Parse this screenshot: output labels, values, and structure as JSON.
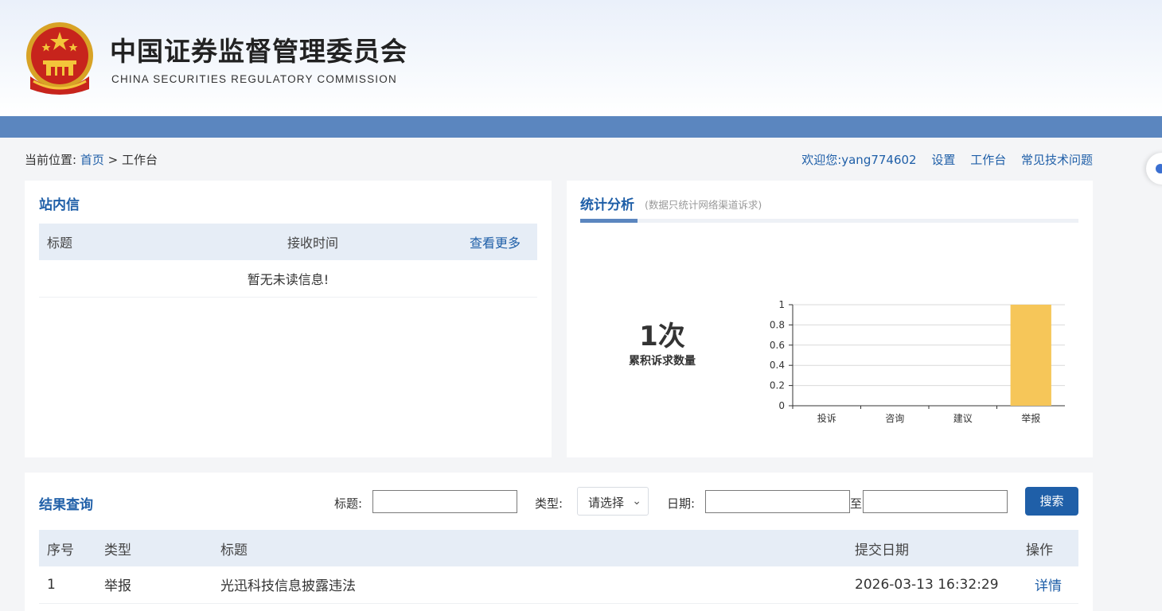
{
  "header": {
    "title_cn": "中国证券监督管理委员会",
    "title_en": "CHINA SECURITIES REGULATORY COMMISSION"
  },
  "breadcrumb": {
    "prefix": "当前位置:",
    "home": "首页",
    "separator": ">",
    "current": "工作台"
  },
  "userbar": {
    "welcome": "欢迎您:yang774602",
    "settings": "设置",
    "workbench": "工作台",
    "faq": "常见技术问题"
  },
  "inbox": {
    "title": "站内信",
    "col_title": "标题",
    "col_time": "接收时间",
    "more": "查看更多",
    "empty": "暂无未读信息!"
  },
  "stats": {
    "title": "统计分析",
    "subtitle": "(数据只统计网络渠道诉求)",
    "count": "1次",
    "count_label": "累积诉求数量"
  },
  "chart_data": {
    "type": "bar",
    "categories": [
      "投诉",
      "咨询",
      "建议",
      "举报"
    ],
    "values": [
      0,
      0,
      0,
      1
    ],
    "ylim": [
      0,
      1
    ],
    "yticks": [
      "0",
      "0.2",
      "0.4",
      "0.6",
      "0.8",
      "1"
    ],
    "bar_color": "#f6c659",
    "grid": true
  },
  "query": {
    "title": "结果查询",
    "label_title": "标题:",
    "label_type": "类型:",
    "type_placeholder": "请选择",
    "label_date": "日期:",
    "to": "至",
    "search": "搜索",
    "columns": [
      "序号",
      "类型",
      "标题",
      "提交日期",
      "操作"
    ],
    "rows": [
      {
        "no": "1",
        "type": "举报",
        "title": "光迅科技信息披露违法",
        "date": "2026-03-13 16:32:29",
        "action": "详情"
      }
    ]
  },
  "colors": {
    "brand_blue": "#1f5fa8",
    "nav_blue": "#5b86bf",
    "header_bg": "#e6edf6"
  }
}
